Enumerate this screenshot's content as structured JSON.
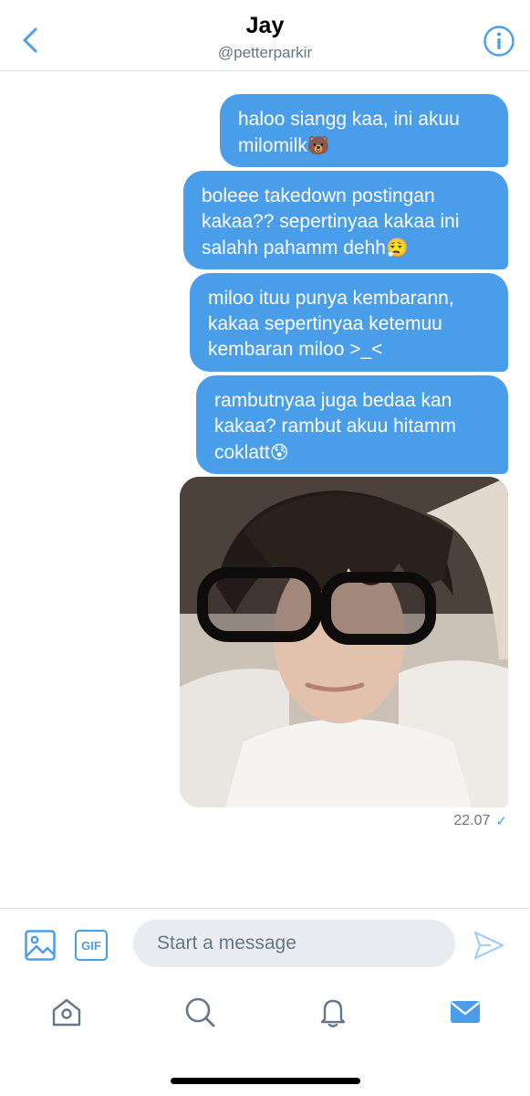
{
  "header": {
    "title": "Jay",
    "handle": "@petterparkir",
    "back_icon": "chevron-left-icon",
    "info_icon": "info-icon"
  },
  "messages": [
    {
      "text": "haloo siangg kaa, ini akuu milomilk",
      "emoji": "🐻"
    },
    {
      "text": "boleee takedown postingan kakaa?? sepertinyaa kakaa ini salahh pahamm dehh",
      "emoji": "😮‍💨"
    },
    {
      "text": "miloo ituu punya kembarann, kakaa sepertinyaa ketemuu kembaran miloo >_<",
      "emoji": ""
    },
    {
      "text": "rambutnyaa juga bedaa kan kakaa? rambut akuu hitamm coklatt",
      "emoji": "😰"
    }
  ],
  "photo_message": {
    "alt": "photo"
  },
  "timestamp": "22.07",
  "read_status": "✓",
  "composer": {
    "placeholder": "Start a message",
    "gif_label": "GIF",
    "image_icon": "image-icon",
    "send_icon": "send-icon"
  },
  "tabbar": {
    "items": [
      "home-icon",
      "search-icon",
      "notifications-icon",
      "messages-icon"
    ],
    "active": "messages-icon"
  },
  "colors": {
    "accent": "#4a9de8",
    "bubble": "#4a9de8",
    "muted": "#657786",
    "divider": "#e1e6ea",
    "input_bg": "#e8ecf0"
  }
}
